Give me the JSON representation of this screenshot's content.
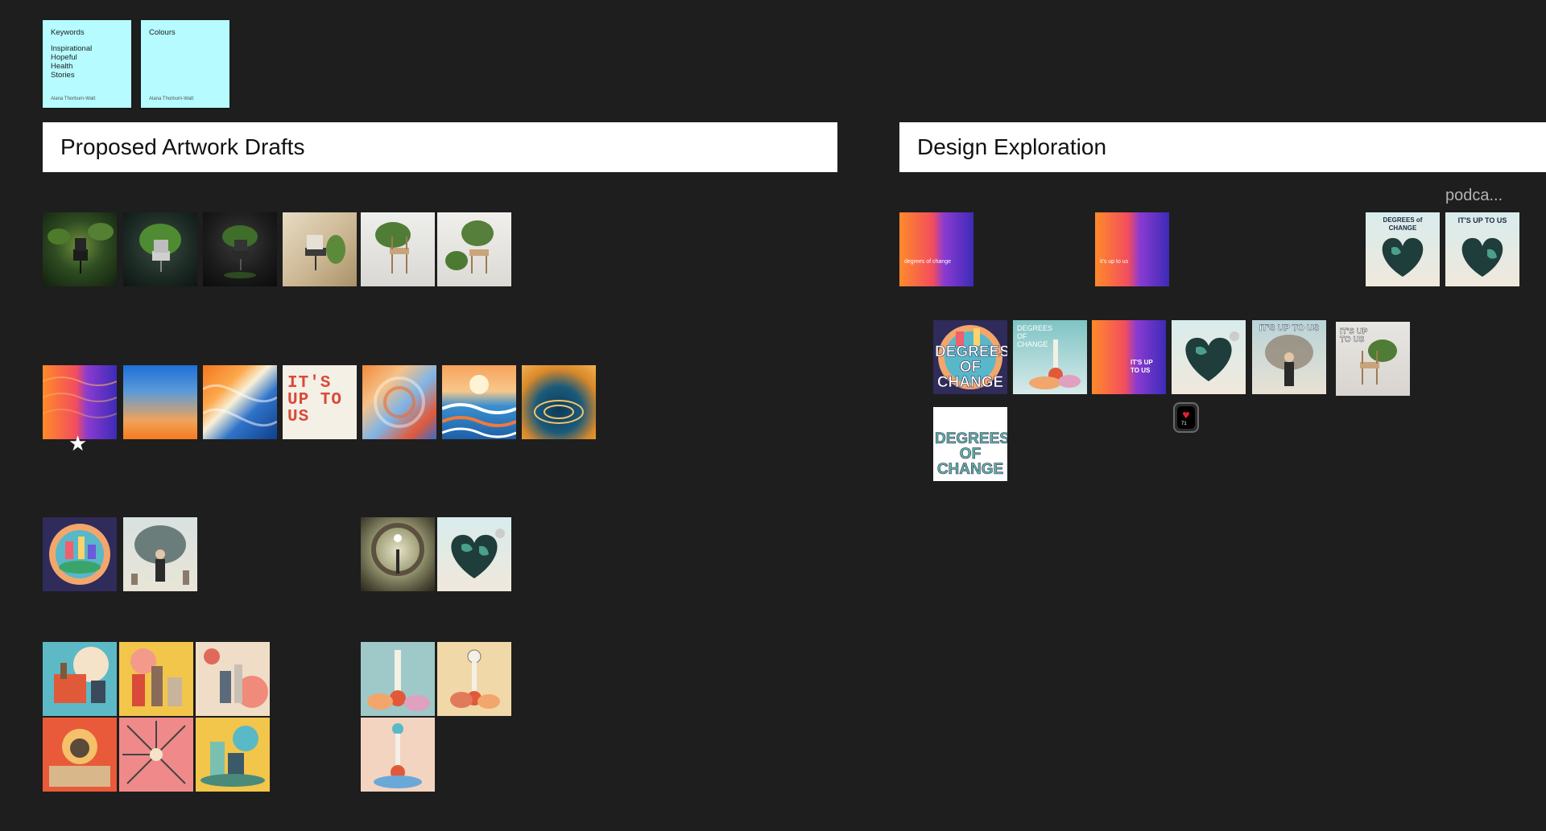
{
  "sticky_notes": [
    {
      "title": "Keywords",
      "lines": [
        "Inspirational",
        "Hopeful",
        "Health",
        "Stories"
      ],
      "author": "Alana Thorburn-Watt",
      "color": "#b5fbff"
    },
    {
      "title": "Colours",
      "lines": [],
      "author": "Alana Thorburn-Watt",
      "color": "#b5fbff"
    }
  ],
  "sections": {
    "proposed": {
      "title": "Proposed Artwork Drafts"
    },
    "exploration": {
      "title": "Design Exploration",
      "overflow_label": "podca..."
    }
  },
  "favourite_marker": "★",
  "tile_text": {
    "doc_1": "degrees of change",
    "iuu_1": "it's up to us",
    "dc_heart": "DEGREES of CHANGE",
    "iuts_heart": "IT'S UP TO US",
    "dc_big": "DEGREES OF CHANGE",
    "dc_pastel": "DEGREES OF CHANGE",
    "iuts_grad": "IT'S UP TO US",
    "iuts_collage": "IT'S UP TO US",
    "iuts_chair": "IT'S UP TO US",
    "dc_white": "DEGREES OF CHANGE",
    "iuts_type": "IT'S UP TO US"
  },
  "watch": {
    "reading": "71"
  },
  "colors": {
    "canvas": "#1e1e1e",
    "sticky": "#b5fbff",
    "header_bg": "#ffffff"
  }
}
